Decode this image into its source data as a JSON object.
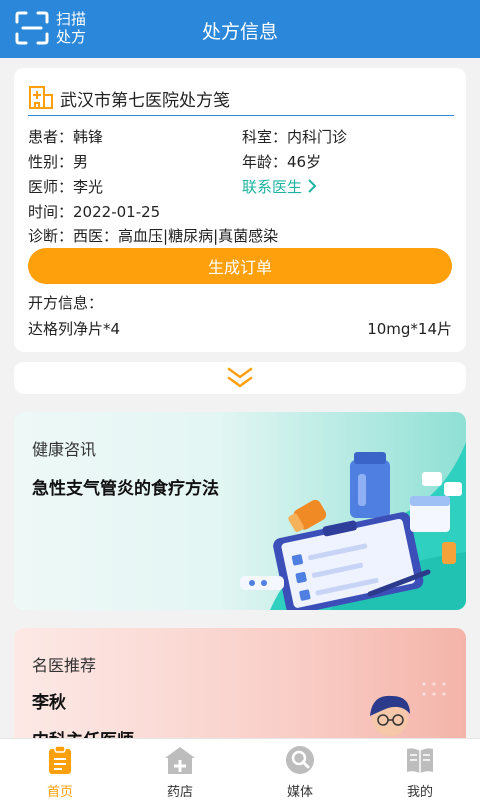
{
  "header": {
    "title": "处方信息",
    "scan_label": "扫描处方"
  },
  "prescription": {
    "hospital": "武汉市第七医院处方笺",
    "patient_label": "患者：",
    "patient": "韩锋",
    "department_label": "科室：",
    "department": "内科门诊",
    "gender_label": "性别：",
    "gender": "男",
    "age_label": "年龄：",
    "age": "46岁",
    "doctor_label": "医师：",
    "doctor": "李光",
    "contact_doctor": "联系医生",
    "time_label": "时间：",
    "time": "2022-01-25",
    "diagnosis_label": "诊断：",
    "diagnosis": "西医：高血压|糖尿病|真菌感染",
    "order_button": "生成订单",
    "rx_info_label": "开方信息：",
    "drug_name": "达格列净片*4",
    "drug_spec": "10mg*14片"
  },
  "health": {
    "label": "健康咨讯",
    "title": "急性支气管炎的食疗方法"
  },
  "recommend": {
    "label": "名医推荐",
    "name": "李秋",
    "title": "内科主任医师"
  },
  "nav": {
    "items": [
      {
        "label": "首页",
        "icon": "clipboard-icon",
        "active": true
      },
      {
        "label": "药店",
        "icon": "pharmacy-icon",
        "active": false
      },
      {
        "label": "媒体",
        "icon": "search-icon",
        "active": false
      },
      {
        "label": "我的",
        "icon": "book-icon",
        "active": false
      }
    ]
  },
  "colors": {
    "header_bg": "#2b87d9",
    "accent_orange": "#fea00c",
    "link_teal": "#1fb4a2",
    "health_teal": "#2fd0c0",
    "doctor_pink": "#f4b4a9"
  }
}
